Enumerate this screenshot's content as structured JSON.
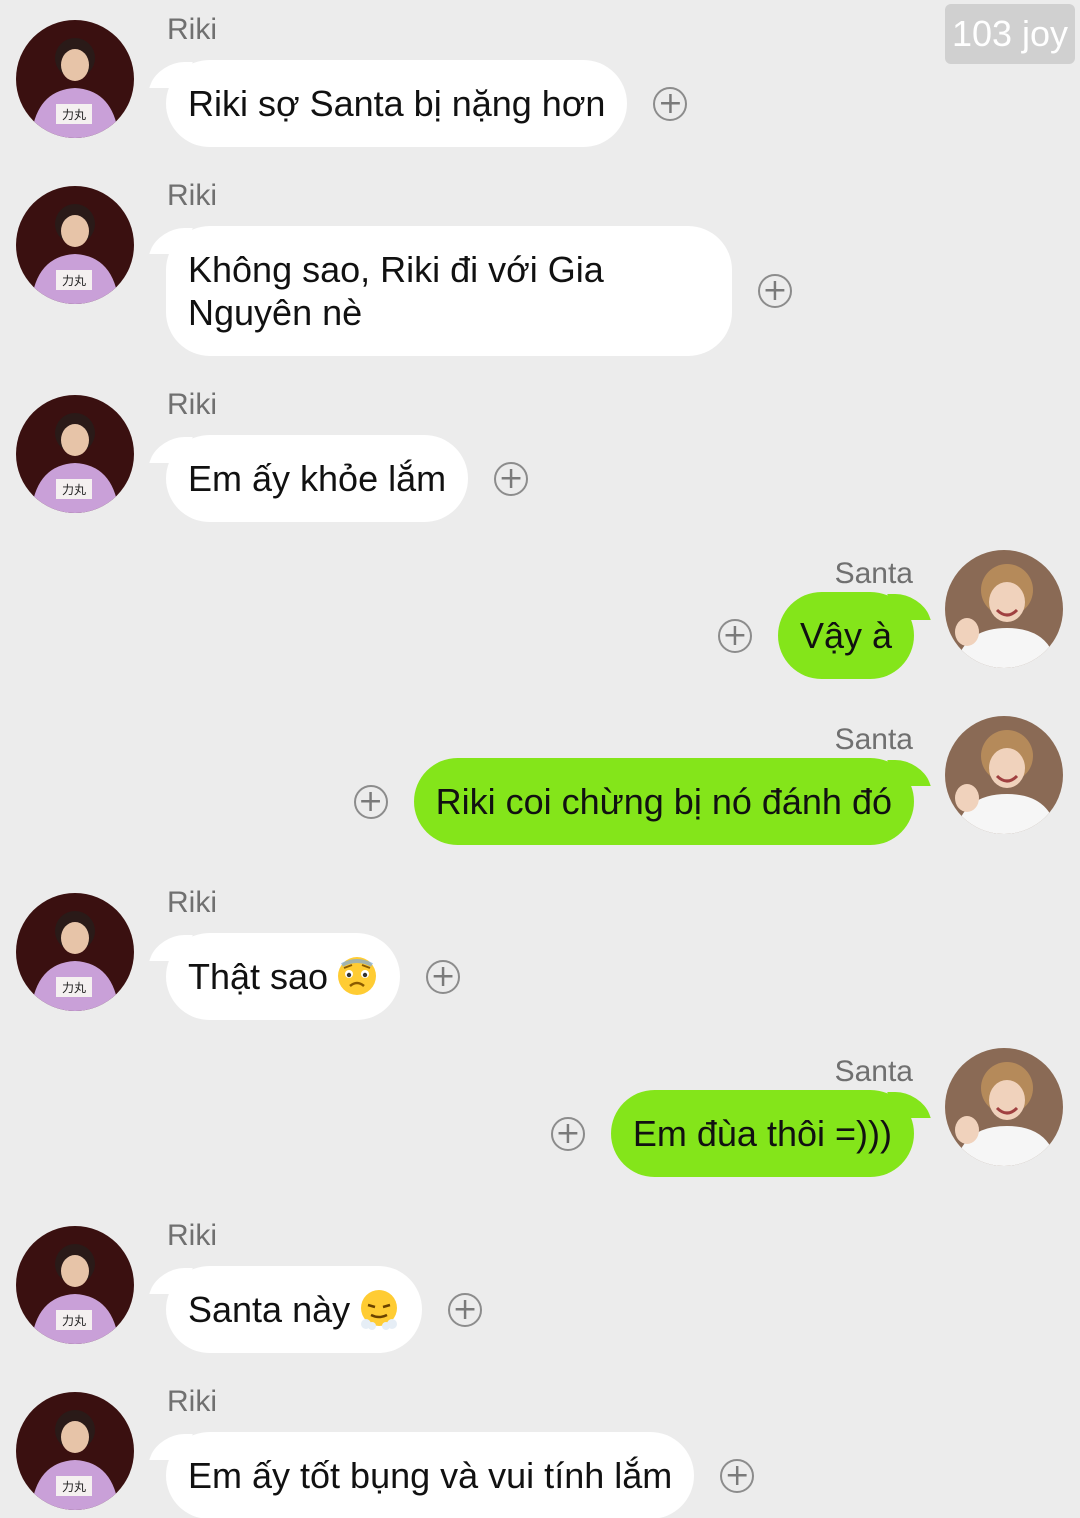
{
  "watermark": "103 joy",
  "colors": {
    "background": "#ececec",
    "incoming_bubble": "#ffffff",
    "outgoing_bubble": "#84e51a"
  },
  "messages": [
    {
      "direction": "in",
      "sender": "Riki",
      "text": "Riki sợ Santa bị nặng hơn",
      "emoji": ""
    },
    {
      "direction": "in",
      "sender": "Riki",
      "text": "Không sao, Riki đi với Gia Nguyên nè",
      "emoji": ""
    },
    {
      "direction": "in",
      "sender": "Riki",
      "text": "Em ấy khỏe lắm",
      "emoji": ""
    },
    {
      "direction": "out",
      "sender": "Santa",
      "text": "Vậy à",
      "emoji": ""
    },
    {
      "direction": "out",
      "sender": "Santa",
      "text": "Riki coi chừng bị nó đánh đó",
      "emoji": ""
    },
    {
      "direction": "in",
      "sender": "Riki",
      "text": "Thật sao",
      "emoji": "anxious-face-icon"
    },
    {
      "direction": "out",
      "sender": "Santa",
      "text": "Em đùa thôi =)))",
      "emoji": ""
    },
    {
      "direction": "in",
      "sender": "Riki",
      "text": "Santa này",
      "emoji": "steam-face-icon"
    },
    {
      "direction": "in",
      "sender": "Riki",
      "text": "Em ấy tốt bụng và vui tính lắm",
      "emoji": ""
    }
  ],
  "add_button_icon": "plus-circle-icon",
  "avatar_icons": {
    "Riki": "riki-avatar",
    "Santa": "santa-avatar"
  }
}
